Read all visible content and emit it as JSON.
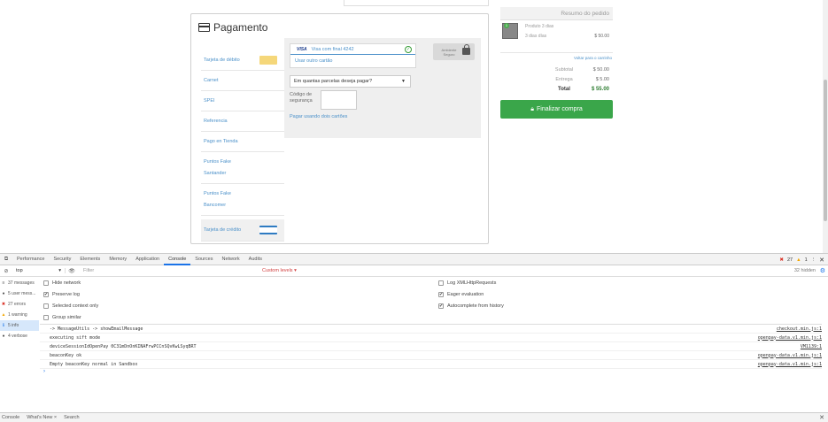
{
  "payment": {
    "title": "Pagamento",
    "methods": [
      {
        "label": "Tarjeta de débito"
      },
      {
        "label": "Carnet"
      },
      {
        "label": "SPEI"
      },
      {
        "label": "Referencia"
      },
      {
        "label": "Pago en Tienda"
      },
      {
        "label": "Puntos Fake",
        "sub": "Santander"
      },
      {
        "label": "Puntos Fake",
        "sub": "Bancomer"
      },
      {
        "label": "Tarjeta de crédito"
      }
    ],
    "card_brand": "VISA",
    "card_label": "Visa com final 4242",
    "other_card": "Usar outro cartão",
    "secure_label": "Ambiente Seguro",
    "installments_placeholder": "Em quantas parcelas deseja pagar?",
    "cvv_label": "Código de segurança",
    "two_cards_link": "Pagar usando dois cartões"
  },
  "summary": {
    "title": "Resumo do pedido",
    "product_name": "Produto 3 dias",
    "product_days": "3 dias días",
    "product_price": "$ 50.00",
    "cart_link": "Voltar para o carrinho",
    "subtotal_label": "Subtotal",
    "subtotal_value": "$ 50.00",
    "shipping_label": "Entrega",
    "shipping_value": "$ 5.00",
    "total_label": "Total",
    "total_value": "$ 55.00",
    "finalize_label": "Finalizar compra",
    "item_count": "1"
  },
  "devtools": {
    "tabs": [
      "Performance",
      "Security",
      "Elements",
      "Memory",
      "Application",
      "Console",
      "Sources",
      "Network",
      "Audits"
    ],
    "active_tab": "Console",
    "error_count": "27",
    "warning_count": "1",
    "context": "top",
    "filter_placeholder": "Filter",
    "levels": "Custom levels ▾",
    "hidden_count": "32 hidden",
    "sidebar": [
      {
        "label": "37 messages",
        "icon": "≡"
      },
      {
        "label": "5 user mess...",
        "icon": "●"
      },
      {
        "label": "27 errors",
        "icon": "✖"
      },
      {
        "label": "1 warning",
        "icon": "▲"
      },
      {
        "label": "5 info",
        "icon": "ℹ"
      },
      {
        "label": "4 verbose",
        "icon": "●"
      }
    ],
    "options_left": [
      {
        "label": "Hide network",
        "checked": false
      },
      {
        "label": "Preserve log",
        "checked": true
      },
      {
        "label": "Selected context only",
        "checked": false
      },
      {
        "label": "Group similar",
        "checked": false
      }
    ],
    "options_right": [
      {
        "label": "Log XMLHttpRequests",
        "checked": false
      },
      {
        "label": "Eager evaluation",
        "checked": true
      },
      {
        "label": "Autocomplete from history",
        "checked": true
      }
    ],
    "logs": [
      {
        "msg": "-> MessageUtils -> showEmailMessage",
        "src": "checkout.min.js:1"
      },
      {
        "msg": "executing sift mode",
        "src": "openpay-data.v1.min.js:1"
      },
      {
        "msg": "deviceSessionIdOpenPay 0C31mDnOnKINAFrwPCCnSQvKwLSyqBRT",
        "src": "VM1139:1"
      },
      {
        "msg": "beaconKey ok",
        "src": "openpay-data.v1.min.js:1"
      },
      {
        "msg": "Empty beaconKey normal in Sandbox",
        "src": "openpay-data.v1.min.js:1"
      }
    ],
    "drawer_tabs": [
      "Console",
      "What's New ×",
      "Search"
    ]
  },
  "colors": {
    "accent": "#4a90c9",
    "finalize": "#3aa64a",
    "error": "#d93025",
    "warning": "#f2a600"
  }
}
